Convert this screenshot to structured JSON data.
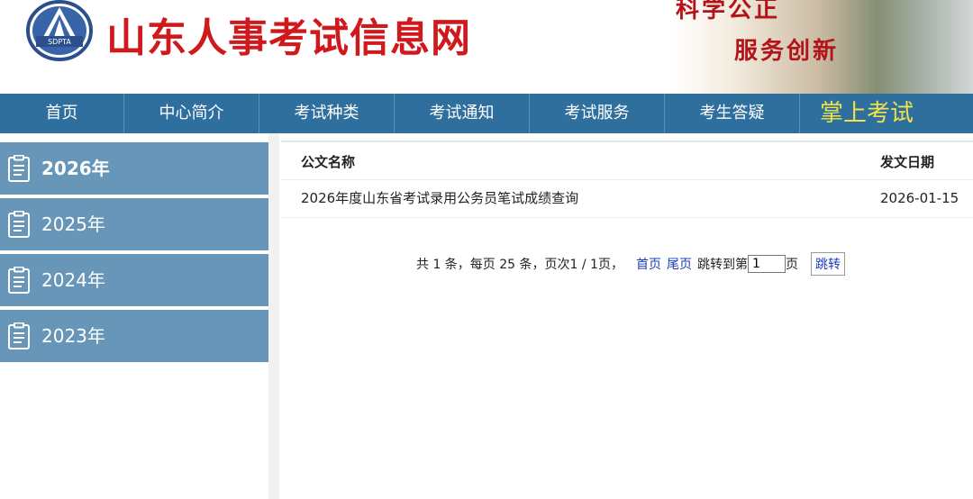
{
  "header": {
    "logo_text": "SDPTA",
    "title": "山东人事考试信息网",
    "banner_line1": "科学公正",
    "banner_line2": "服务创新"
  },
  "nav": {
    "items": [
      "首页",
      "中心简介",
      "考试种类",
      "考试通知",
      "考试服务",
      "考生答疑"
    ],
    "special": "掌上考试"
  },
  "sidebar": {
    "years": [
      "2026年",
      "2025年",
      "2024年",
      "2023年"
    ],
    "active_index": 0
  },
  "table": {
    "col_name": "公文名称",
    "col_date": "发文日期",
    "rows": [
      {
        "name": "2026年度山东省考试录用公务员笔试成绩查询",
        "date": "2026-01-15"
      }
    ]
  },
  "pager": {
    "summary": "共 1 条，每页 25 条，页次1 / 1页，",
    "first": "首页",
    "last": "尾页",
    "jump_prefix": "跳转到第",
    "page_value": "1",
    "jump_suffix": "页",
    "jump_button": "跳转"
  },
  "colors": {
    "nav_bg": "#2e6f9e",
    "sidebar_bg": "#6796b9",
    "title_red": "#d0191c",
    "special_yellow": "#f0e34a",
    "link_blue": "#1a3cba"
  }
}
